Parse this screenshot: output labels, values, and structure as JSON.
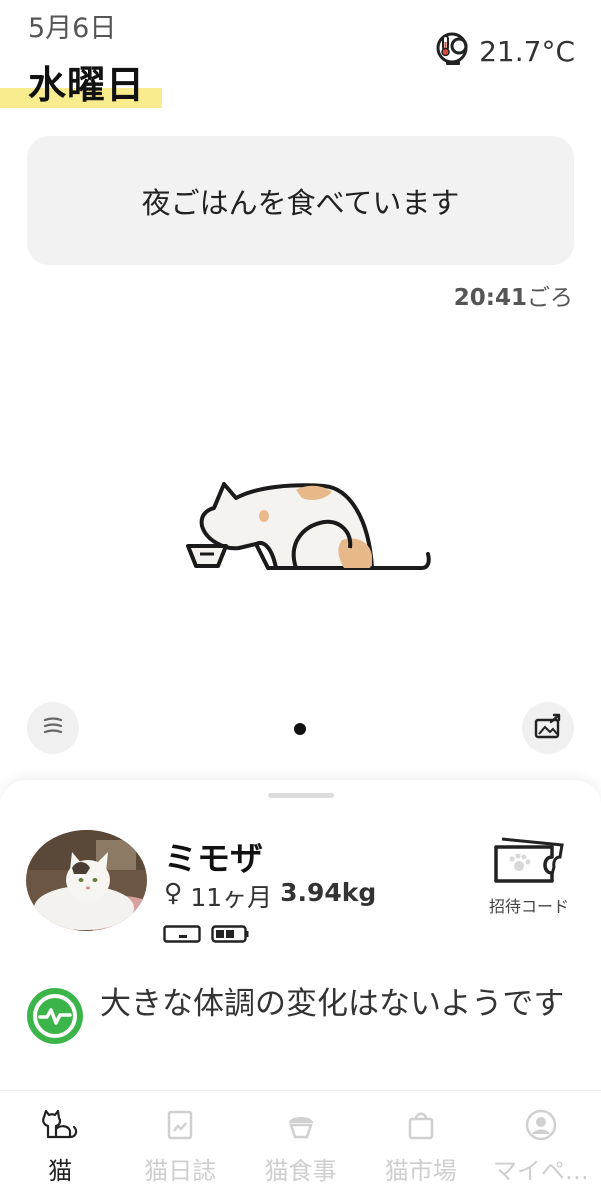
{
  "header": {
    "date": "5月6日",
    "weekday": "水曜日",
    "temperature": "21.7°C",
    "temperature_icon": "device-thermometer-icon"
  },
  "status": {
    "message": "夜ごはんを食べています",
    "time": "20:41",
    "time_suffix": "ごろ"
  },
  "controls": {
    "left_icon": "menu-lines-icon",
    "right_icon": "share-image-icon",
    "page_indicator": {
      "count": 1,
      "active": 0
    }
  },
  "pet": {
    "name": "ミモザ",
    "sex_symbol": "♀",
    "age": "11ヶ月",
    "weight": "3.94kg",
    "devices": [
      "device-battery-low-icon",
      "device-battery-full-icon"
    ]
  },
  "invite": {
    "label": "招待コード",
    "icon": "ticket-paw-icon"
  },
  "health": {
    "message": "大きな体調の変化はないようです",
    "icon": "health-check-icon",
    "color": "#3bb54a"
  },
  "tabs": [
    {
      "label": "猫",
      "icon": "cat-icon",
      "active": true
    },
    {
      "label": "猫日誌",
      "icon": "journal-icon",
      "active": false
    },
    {
      "label": "猫食事",
      "icon": "food-bowl-icon",
      "active": false
    },
    {
      "label": "猫市場",
      "icon": "shopping-bag-icon",
      "active": false
    },
    {
      "label": "マイペ…",
      "icon": "profile-icon",
      "active": false
    }
  ],
  "colors": {
    "accent": "#f9ec8f",
    "card_bg": "#f2f2f2",
    "cat_patch": "#e7b98a",
    "inactive": "#cfcfcf"
  }
}
